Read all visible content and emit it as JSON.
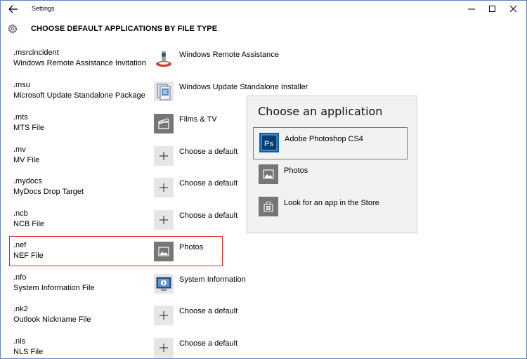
{
  "window": {
    "title": "Settings"
  },
  "header": {
    "title": "CHOOSE DEFAULT APPLICATIONS BY FILE TYPE"
  },
  "file_types": [
    {
      "ext": ".msrcincident",
      "desc": "Windows Remote Assistance Invitation",
      "app": "Windows Remote Assistance",
      "icon": "remote-assistance-icon"
    },
    {
      "ext": ".msu",
      "desc": "Microsoft Update Standalone Package",
      "app": "Windows Update Standalone Installer",
      "icon": "update-installer-icon"
    },
    {
      "ext": ".mts",
      "desc": "MTS File",
      "app": "Films & TV",
      "icon": "films-tv-icon"
    },
    {
      "ext": ".mv",
      "desc": "MV File",
      "app": "Choose a default",
      "icon": "plus-icon"
    },
    {
      "ext": ".mydocs",
      "desc": "MyDocs Drop Target",
      "app": "Choose a default",
      "icon": "plus-icon"
    },
    {
      "ext": ".ncb",
      "desc": "NCB File",
      "app": "Choose a default",
      "icon": "plus-icon"
    },
    {
      "ext": ".nef",
      "desc": "NEF File",
      "app": "Photos",
      "icon": "photos-icon"
    },
    {
      "ext": ".nfo",
      "desc": "System Information File",
      "app": "System Information",
      "icon": "system-information-icon"
    },
    {
      "ext": ".nk2",
      "desc": "Outlook Nickname File",
      "app": "Choose a default",
      "icon": "plus-icon"
    },
    {
      "ext": ".nls",
      "desc": "NLS File",
      "app": "Choose a default",
      "icon": "plus-icon"
    }
  ],
  "flyout": {
    "title": "Choose an application",
    "items": [
      {
        "label": "Adobe Photoshop CS4",
        "icon": "photoshop-icon",
        "selected": true
      },
      {
        "label": "Photos",
        "icon": "photos-icon",
        "selected": false
      },
      {
        "label": "Look for an app in the Store",
        "icon": "store-icon",
        "selected": false
      }
    ]
  },
  "colors": {
    "highlight_border": "#e0262b",
    "tile_gray": "#767676",
    "tile_light": "#e6e6e6",
    "photoshop_blue": "#0d5fa8"
  }
}
